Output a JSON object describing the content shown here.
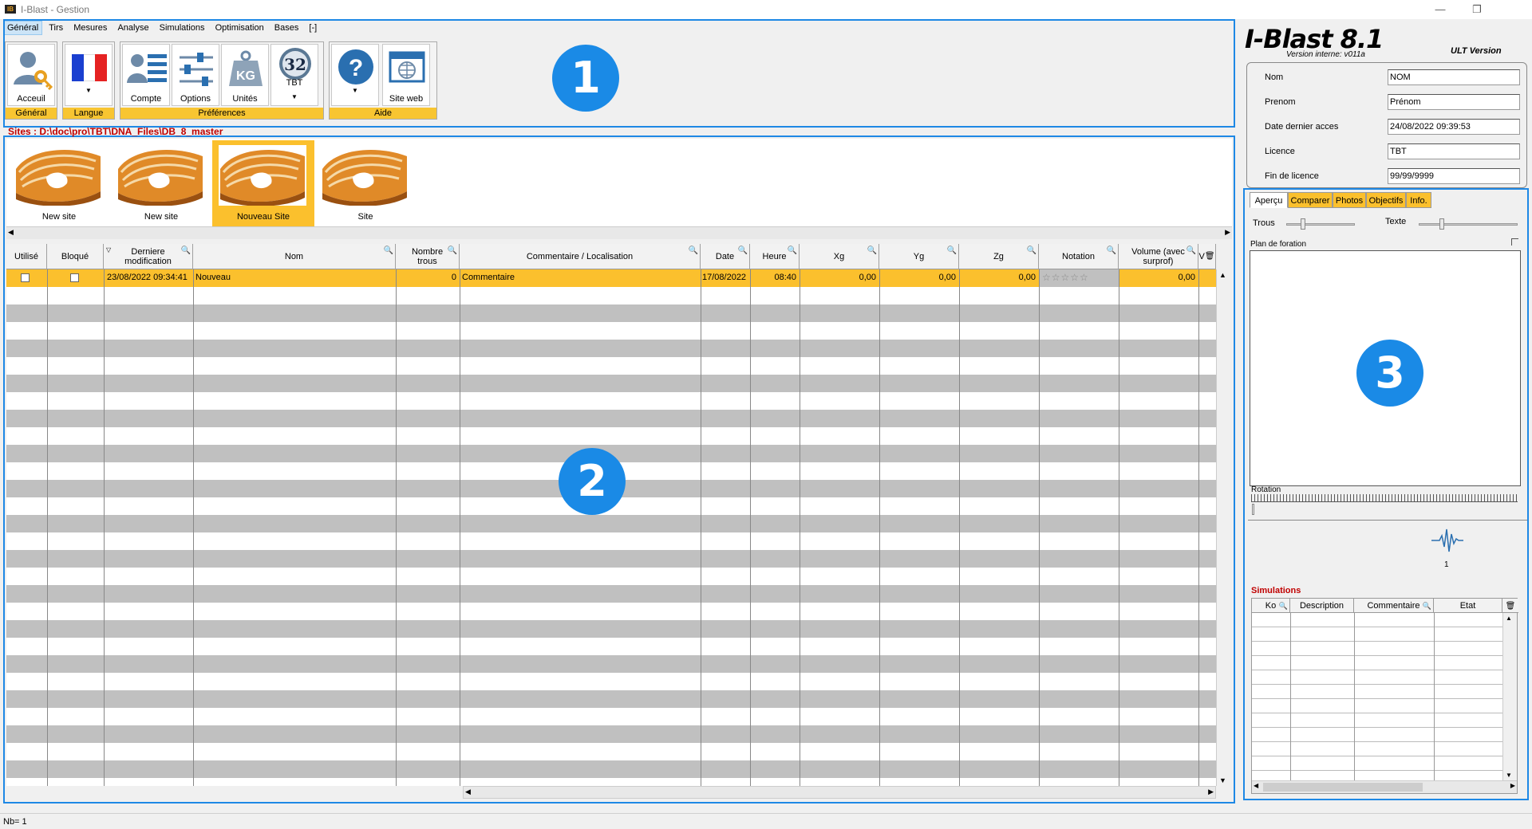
{
  "window": {
    "title": "I-Blast - Gestion",
    "icon_text": "IB",
    "controls": {
      "minimize": "—",
      "restore": "❐",
      "close": "✕"
    }
  },
  "menu": [
    "Général",
    "Tirs",
    "Mesures",
    "Analyse",
    "Simulations",
    "Optimisation",
    "Bases",
    "[-]"
  ],
  "ribbon": {
    "groups": [
      {
        "label": "Général",
        "buttons": [
          "Acceuil"
        ]
      },
      {
        "label": "Langue",
        "buttons": [
          ""
        ]
      },
      {
        "label": "Préférences",
        "buttons": [
          "Compte",
          "Options",
          "Unités",
          "TBT"
        ]
      },
      {
        "label": "Aide",
        "buttons": [
          "",
          "Site web"
        ]
      }
    ],
    "units_icon_text": "KG",
    "tbt_icon_text": "32"
  },
  "badges": [
    "1",
    "2",
    "3"
  ],
  "sites": {
    "path": "Sites : D:\\doc\\pro\\TBT\\DNA_Files\\DB_8_master",
    "items": [
      {
        "label": "New site",
        "selected": false
      },
      {
        "label": "New site",
        "selected": false
      },
      {
        "label": "Nouveau Site",
        "selected": true
      },
      {
        "label": "Site",
        "selected": false
      }
    ]
  },
  "grid": {
    "headers": [
      "Utilisé",
      "Bloqué",
      "Derniere modification",
      "Nom",
      "Nombre trous",
      "Commentaire / Localisation",
      "Date",
      "Heure",
      "Xg",
      "Yg",
      "Zg",
      "Notation",
      "Volume (avec surprof)",
      "V"
    ],
    "selected_row": {
      "utilise": false,
      "bloque": false,
      "derniere_modification": "23/08/2022 09:34:41",
      "nom": "Nouveau",
      "nombre_trous": "0",
      "commentaire": "Commentaire",
      "date": "17/08/2022",
      "heure": "08:40",
      "xg": "0,00",
      "yg": "0,00",
      "zg": "0,00",
      "notation": "☆☆☆☆☆",
      "volume": "0,00"
    }
  },
  "status_bar": "Nb= 1",
  "right_panel": {
    "logo": "I-Blast 8.1",
    "version": "Version interne: v011a",
    "edition": "ULT Version",
    "user": [
      {
        "label": "Nom",
        "value": "NOM"
      },
      {
        "label": "Prenom",
        "value": "Prénom"
      },
      {
        "label": "Date dernier acces",
        "value": "24/08/2022 09:39:53"
      },
      {
        "label": "Licence",
        "value": "TBT"
      },
      {
        "label": "Fin de licence",
        "value": "99/99/9999"
      }
    ],
    "tabs": [
      "Aperçu",
      "Comparer",
      "Photos",
      "Objectifs",
      "Info."
    ],
    "sliders": {
      "trous": "Trous",
      "texte": "Texte"
    },
    "plan_label": "Plan de foration",
    "rotation_label": "Rotation",
    "wave_count": "1",
    "simulations": {
      "title": "Simulations",
      "headers": [
        "Ko",
        "Description",
        "Commentaire",
        "Etat"
      ]
    }
  },
  "colors": {
    "accent": "#1e88e5",
    "selection": "#fbc02d",
    "alt_row": "#c0c0c0",
    "sites_path": "#c00000"
  }
}
